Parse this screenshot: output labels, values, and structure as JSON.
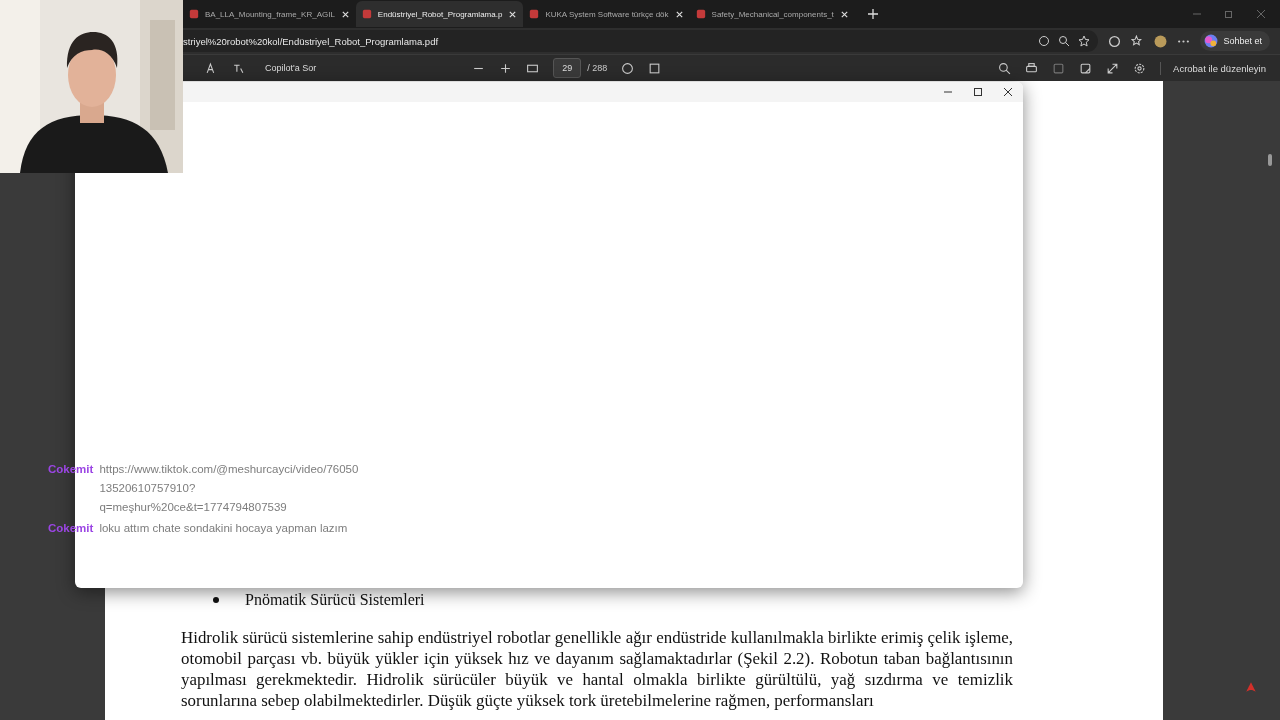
{
  "tabs": [
    {
      "label": "BA_LLA_Mounting_frame_KR_AGIL",
      "selected": false
    },
    {
      "label": "Endüstriyel_Robot_Programlama.p",
      "selected": true
    },
    {
      "label": "KUKA System Software türkçe dök",
      "selected": false
    },
    {
      "label": "Safety_Mechanical_components_t",
      "selected": false
    }
  ],
  "address_bar": {
    "url": "striyel%20robot%20kol/Endüstriyel_Robot_Programlama.pdf"
  },
  "chat_button": "Sohbet et",
  "pdf_toolbar": {
    "copilot": "Copilot'a Sor",
    "page_number": "29",
    "page_total": "/ 288",
    "edit_button": "Acrobat ile düzenleyin"
  },
  "pdf_page": {
    "bullets": [
      "Pnömatik Sürücü Sistemleri"
    ],
    "paragraph": "Hidrolik sürücü sistemlerine sahip endüstriyel robotlar genellikle ağır endüstride kullanılmakla birlikte erimiş çelik işleme, otomobil parçası vb. büyük yükler için yüksek hız ve dayanım sağlamaktadırlar (Şekil 2.2). Robotun taban bağlantısının yapılması gerekmektedir. Hidrolik sürücüler büyük ve hantal olmakla birlikte gürültülü, yağ sızdırma ve temizlik sorunlarına sebep olabilmektedirler. Düşük güçte yüksek tork üretebilmelerine rağmen, performansları"
  },
  "chat_overlay": [
    {
      "user": "Cokemit",
      "text": "https://www.tiktok.com/@meshurcayci/video/7605013520610757910?q=meşhur%20ce&t=1774794807539"
    },
    {
      "user": "Cokemit",
      "text": "loku attım chate sondakini hocaya yapman lazım"
    }
  ]
}
